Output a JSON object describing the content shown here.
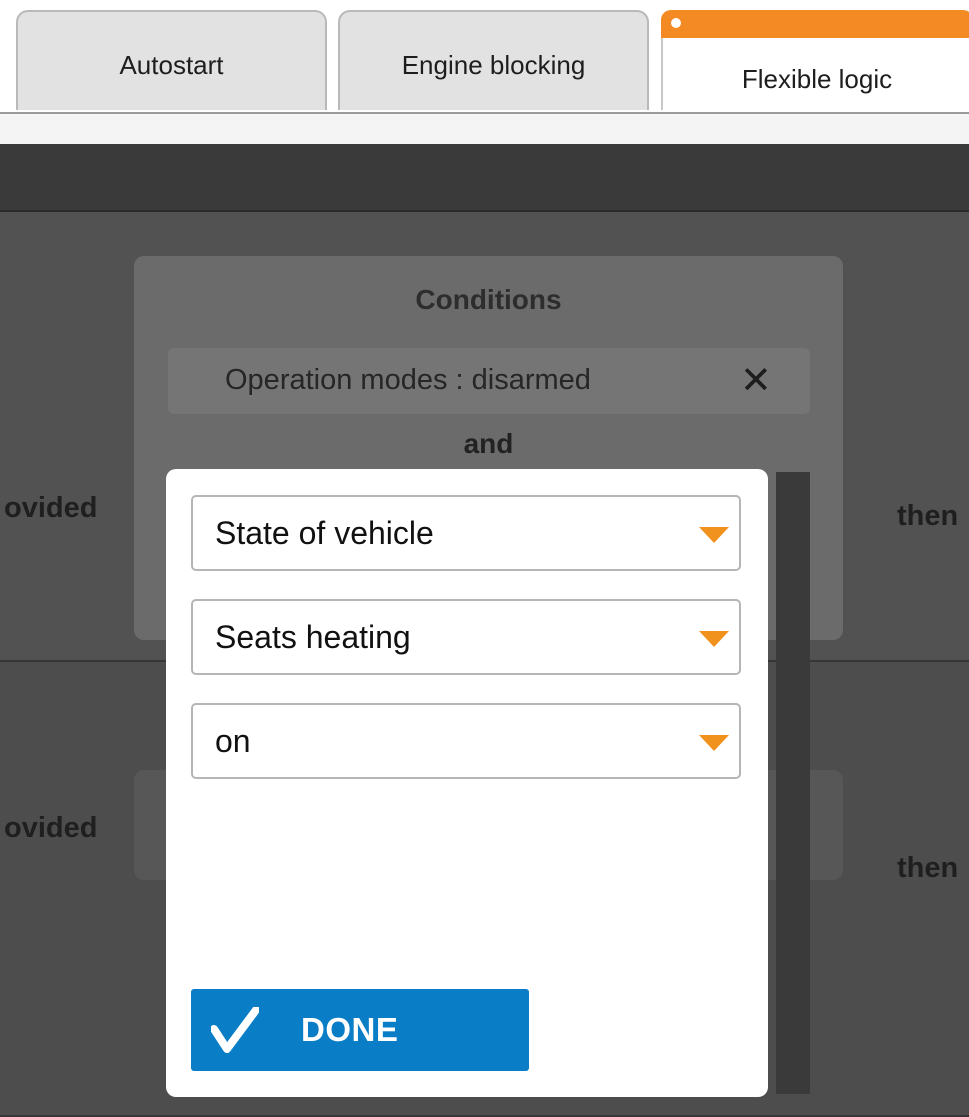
{
  "tabs": [
    {
      "label": "Autostart",
      "active": false
    },
    {
      "label": "Engine blocking",
      "active": false
    },
    {
      "label": "Flexible logic",
      "active": true
    }
  ],
  "rules": [
    {
      "provided_label": "ovided",
      "then_label": "then"
    },
    {
      "provided_label": "ovided",
      "then_label": "then"
    }
  ],
  "conditions": {
    "title": "Conditions",
    "items": [
      {
        "text": "Operation modes : disarmed"
      }
    ],
    "connector": "and"
  },
  "modal": {
    "selects": [
      {
        "value": "State of vehicle"
      },
      {
        "value": "Seats heating"
      },
      {
        "value": "on"
      }
    ],
    "done_label": "DONE"
  },
  "colors": {
    "accent_orange": "#f38a24",
    "done_blue": "#0a7dc7"
  },
  "icons": {
    "close": "close-icon",
    "dropdown": "chevron-down-icon",
    "check": "checkmark-icon"
  }
}
